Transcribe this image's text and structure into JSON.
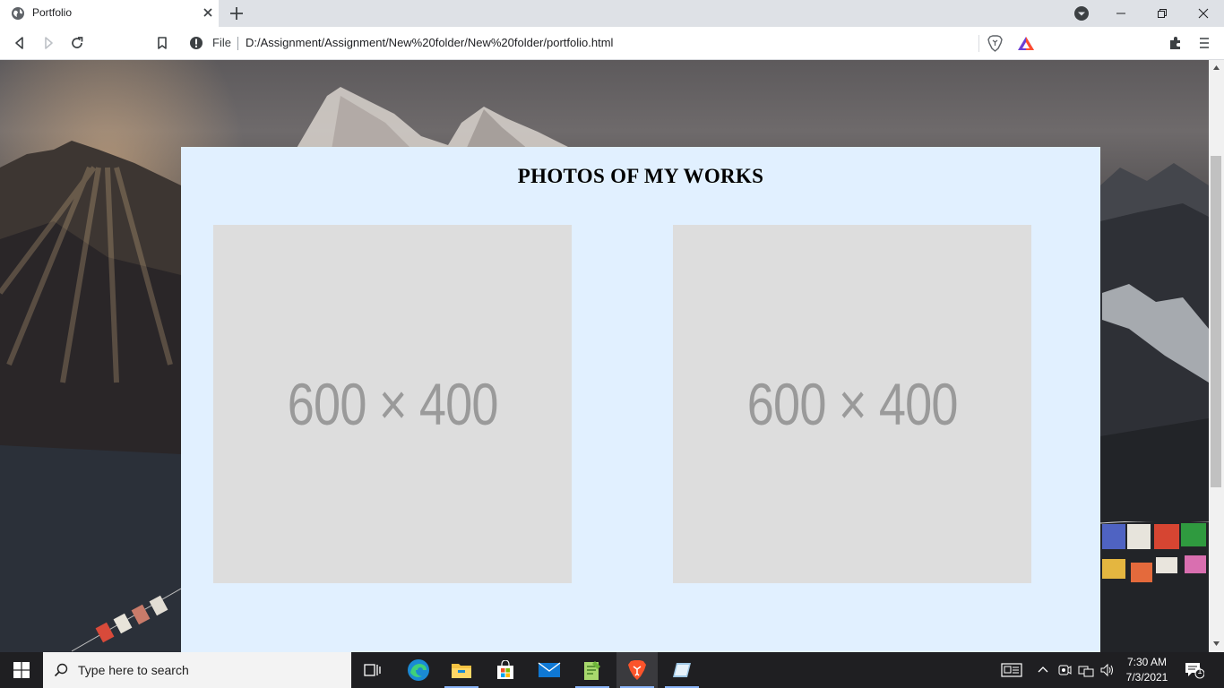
{
  "browser": {
    "tab_title": "Portfolio",
    "omnibox": {
      "scheme_label": "File",
      "url": "D:/Assignment/Assignment/New%20folder/New%20folder/portfolio.html"
    }
  },
  "page": {
    "section_title": "PHOTOS OF MY WORKS",
    "photos": [
      {
        "label": "600 × 400"
      },
      {
        "label": "600 × 400"
      }
    ],
    "panel_color": "#e1f0ff",
    "placeholder_color": "#dddddd"
  },
  "taskbar": {
    "search_placeholder": "Type here to search",
    "apps": [
      "task-view",
      "edge",
      "file-explorer",
      "store",
      "mail",
      "notepad-plus",
      "brave",
      "app-window"
    ],
    "clock_time": "7:30 AM",
    "clock_date": "7/3/2021",
    "notification_count": "1"
  }
}
